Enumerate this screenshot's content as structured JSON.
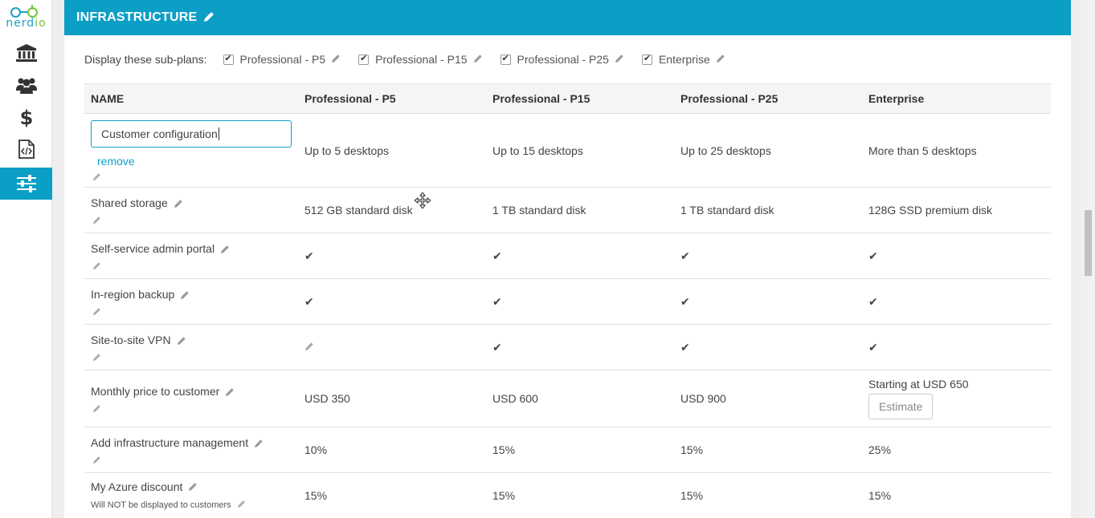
{
  "logo": {
    "text_a": "nerd",
    "text_b": "io"
  },
  "sidebar": {
    "items": [
      {
        "icon": "bank-icon"
      },
      {
        "icon": "users-icon"
      },
      {
        "icon": "dollar-icon"
      },
      {
        "icon": "code-file-icon"
      },
      {
        "icon": "sliders-icon",
        "active": true
      }
    ]
  },
  "header": {
    "title": "INFRASTRUCTURE"
  },
  "subplans": {
    "label": "Display these sub-plans:",
    "items": [
      {
        "name": "Professional - P5",
        "checked": true
      },
      {
        "name": "Professional - P15",
        "checked": true
      },
      {
        "name": "Professional - P25",
        "checked": true
      },
      {
        "name": "Enterprise",
        "checked": true
      }
    ]
  },
  "table": {
    "headers": [
      "NAME",
      "Professional - P5",
      "Professional - P15",
      "Professional - P25",
      "Enterprise"
    ],
    "editing_row": {
      "input_value": "Customer configuration",
      "remove_label": "remove",
      "values": [
        "Up to 5 desktops",
        "Up to 15 desktops",
        "Up to 25 desktops",
        "More than 5 desktops"
      ]
    },
    "rows": [
      {
        "name": "Shared storage",
        "values": [
          "512 GB standard disk",
          "1 TB standard disk",
          "1 TB standard disk",
          "128G SSD premium disk"
        ]
      },
      {
        "name": "Self-service admin portal",
        "values": [
          "✔",
          "✔",
          "✔",
          "✔"
        ]
      },
      {
        "name": "In-region backup",
        "values": [
          "✔",
          "✔",
          "✔",
          "✔"
        ]
      },
      {
        "name": "Site-to-site VPN",
        "values": [
          "",
          "✔",
          "✔",
          "✔"
        ]
      },
      {
        "name": "Monthly price to customer",
        "values": [
          "USD 350",
          "USD 600",
          "USD 900",
          "Starting at USD 650"
        ],
        "estimate_label": "Estimate"
      },
      {
        "name": "Add infrastructure management",
        "values": [
          "10%",
          "15%",
          "15%",
          "25%"
        ]
      },
      {
        "name": "My Azure discount",
        "note": "Will NOT be displayed to customers",
        "values": [
          "15%",
          "15%",
          "15%",
          "15%"
        ]
      }
    ]
  },
  "colors": {
    "accent": "#0c9fc6",
    "logo_green": "#7ac143"
  }
}
